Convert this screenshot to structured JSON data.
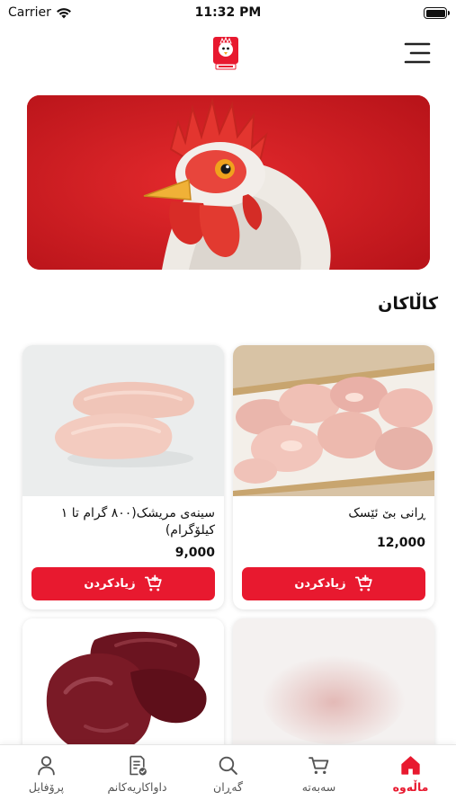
{
  "status": {
    "carrier": "Carrier",
    "time": "11:32 PM"
  },
  "section_title": "کاڵاکان",
  "products": [
    {
      "name": "ڕانی بێ ئێسک",
      "price": "12,000",
      "button_label": "زیادکردن"
    },
    {
      "name": "سینەی مریشک(٨٠٠ گرام تا ١ کیلۆگرام)",
      "price": "9,000",
      "button_label": "زیادکردن"
    }
  ],
  "tabs": [
    {
      "label": "ماڵەوە",
      "icon": "home-icon",
      "active": true
    },
    {
      "label": "سەبەتە",
      "icon": "cart-icon",
      "active": false
    },
    {
      "label": "گەڕان",
      "icon": "search-icon",
      "active": false
    },
    {
      "label": "داواکاریەکانم",
      "icon": "orders-icon",
      "active": false
    },
    {
      "label": "پرۆفایل",
      "icon": "profile-icon",
      "active": false
    }
  ],
  "colors": {
    "accent": "#e8192f",
    "banner_bg": "#d21e23"
  }
}
